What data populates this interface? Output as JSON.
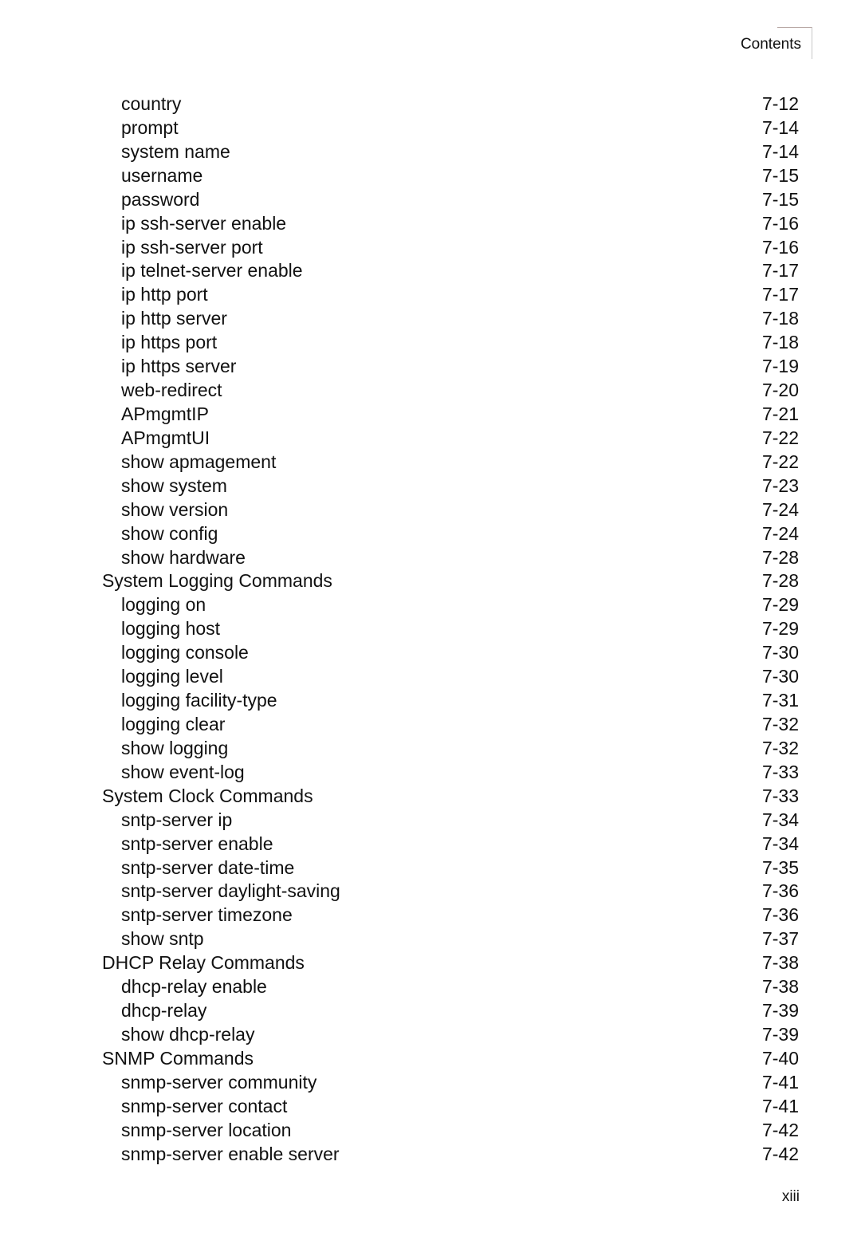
{
  "header": {
    "running_title": "Contents"
  },
  "toc": {
    "entries": [
      {
        "title": "country",
        "page": "7-12",
        "level": 2
      },
      {
        "title": "prompt",
        "page": "7-14",
        "level": 2
      },
      {
        "title": "system name",
        "page": "7-14",
        "level": 2
      },
      {
        "title": "username",
        "page": "7-15",
        "level": 2
      },
      {
        "title": "password",
        "page": "7-15",
        "level": 2
      },
      {
        "title": "ip ssh-server enable",
        "page": "7-16",
        "level": 2
      },
      {
        "title": "ip ssh-server port",
        "page": "7-16",
        "level": 2
      },
      {
        "title": "ip telnet-server enable",
        "page": "7-17",
        "level": 2
      },
      {
        "title": "ip http port",
        "page": "7-17",
        "level": 2
      },
      {
        "title": "ip http server",
        "page": "7-18",
        "level": 2
      },
      {
        "title": "ip https port",
        "page": "7-18",
        "level": 2
      },
      {
        "title": "ip https server",
        "page": "7-19",
        "level": 2
      },
      {
        "title": "web-redirect",
        "page": "7-20",
        "level": 2
      },
      {
        "title": "APmgmtIP",
        "page": "7-21",
        "level": 2
      },
      {
        "title": "APmgmtUI",
        "page": "7-22",
        "level": 2
      },
      {
        "title": "show apmagement",
        "page": "7-22",
        "level": 2
      },
      {
        "title": "show system",
        "page": "7-23",
        "level": 2
      },
      {
        "title": "show version",
        "page": "7-24",
        "level": 2
      },
      {
        "title": "show config",
        "page": "7-24",
        "level": 2
      },
      {
        "title": "show hardware",
        "page": "7-28",
        "level": 2
      },
      {
        "title": "System Logging Commands",
        "page": "7-28",
        "level": 1
      },
      {
        "title": "logging on",
        "page": "7-29",
        "level": 2
      },
      {
        "title": "logging host",
        "page": "7-29",
        "level": 2
      },
      {
        "title": "logging console",
        "page": "7-30",
        "level": 2
      },
      {
        "title": "logging level",
        "page": "7-30",
        "level": 2
      },
      {
        "title": "logging facility-type",
        "page": "7-31",
        "level": 2
      },
      {
        "title": "logging clear",
        "page": "7-32",
        "level": 2
      },
      {
        "title": "show logging",
        "page": "7-32",
        "level": 2
      },
      {
        "title": "show event-log",
        "page": "7-33",
        "level": 2
      },
      {
        "title": "System Clock Commands",
        "page": "7-33",
        "level": 1
      },
      {
        "title": "sntp-server ip",
        "page": "7-34",
        "level": 2
      },
      {
        "title": "sntp-server enable",
        "page": "7-34",
        "level": 2
      },
      {
        "title": "sntp-server date-time",
        "page": "7-35",
        "level": 2
      },
      {
        "title": "sntp-server daylight-saving",
        "page": "7-36",
        "level": 2
      },
      {
        "title": "sntp-server timezone",
        "page": "7-36",
        "level": 2
      },
      {
        "title": "show sntp",
        "page": "7-37",
        "level": 2
      },
      {
        "title": "DHCP Relay Commands",
        "page": "7-38",
        "level": 1
      },
      {
        "title": "dhcp-relay enable",
        "page": "7-38",
        "level": 2
      },
      {
        "title": "dhcp-relay",
        "page": "7-39",
        "level": 2
      },
      {
        "title": "show dhcp-relay",
        "page": "7-39",
        "level": 2
      },
      {
        "title": "SNMP Commands",
        "page": "7-40",
        "level": 1
      },
      {
        "title": "snmp-server community",
        "page": "7-41",
        "level": 2
      },
      {
        "title": "snmp-server contact",
        "page": "7-41",
        "level": 2
      },
      {
        "title": "snmp-server location",
        "page": "7-42",
        "level": 2
      },
      {
        "title": "snmp-server enable server",
        "page": "7-42",
        "level": 2
      }
    ]
  },
  "footer": {
    "page_number": "xiii"
  }
}
